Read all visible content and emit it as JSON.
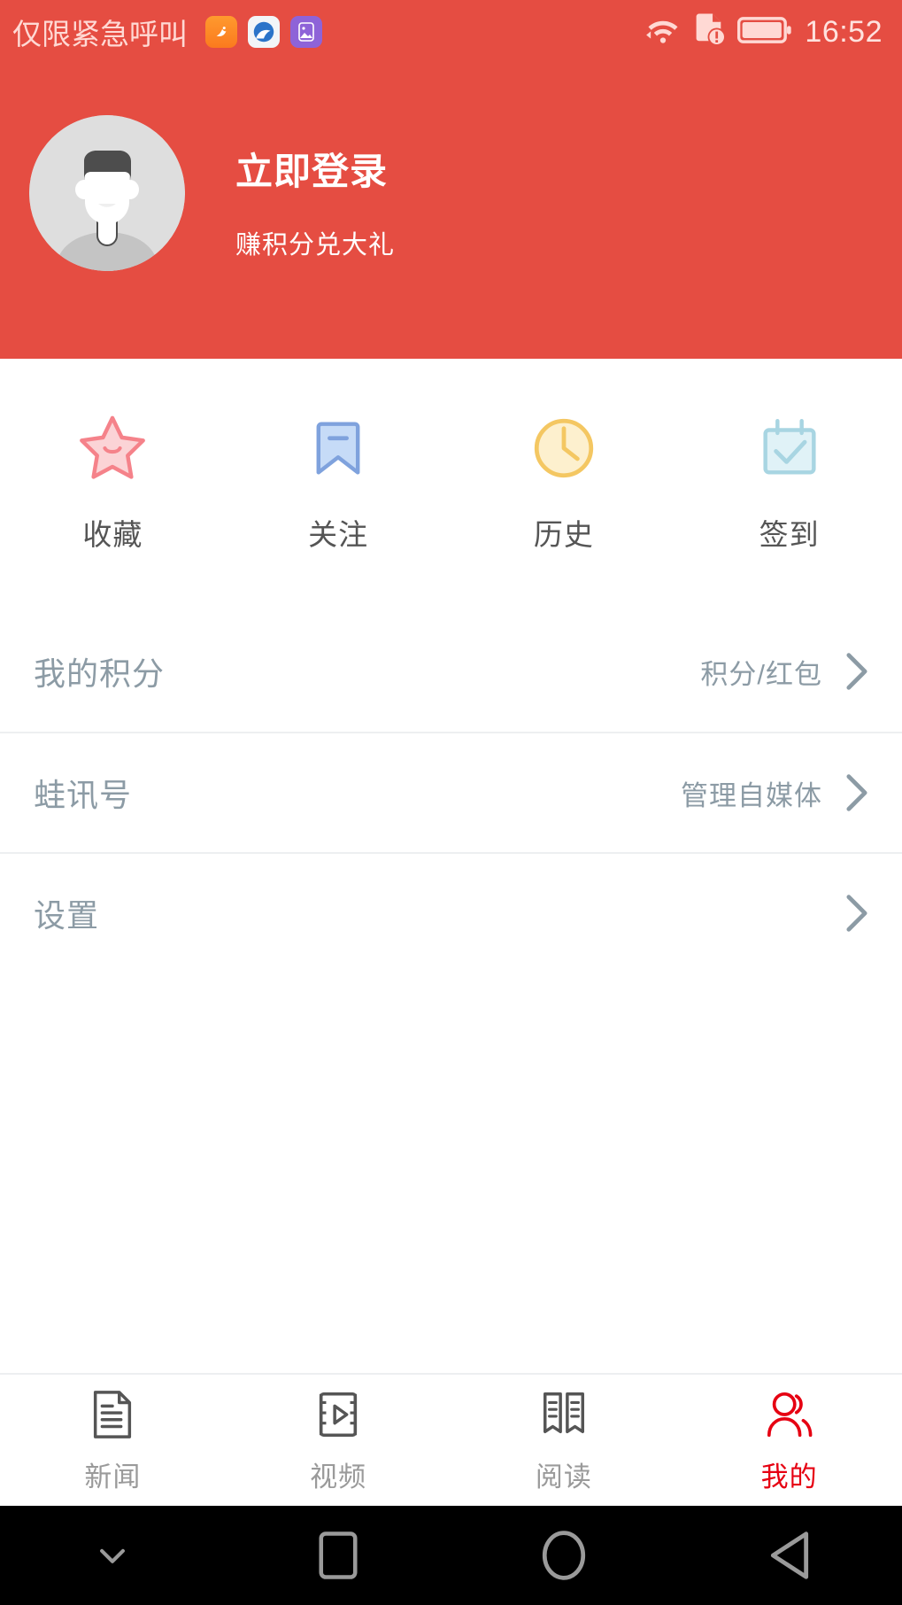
{
  "status_bar": {
    "carrier_text": "仅限紧急呼叫",
    "notification_icons": [
      "uc-browser-icon",
      "cloud-app-icon",
      "purple-app-icon"
    ],
    "system_icons": [
      "wifi-icon",
      "sim-alert-icon",
      "battery-icon"
    ],
    "time": "16:52"
  },
  "header": {
    "avatar": "default-user-avatar",
    "login_title": "立即登录",
    "login_subtitle": "赚积分兑大礼",
    "background_color": "#E54D42"
  },
  "quick_actions": [
    {
      "label": "收藏",
      "icon": "star-icon",
      "color": "#F5828A"
    },
    {
      "label": "关注",
      "icon": "bookmark-icon",
      "color": "#7FA2DD"
    },
    {
      "label": "历史",
      "icon": "clock-icon",
      "color": "#F4C762"
    },
    {
      "label": "签到",
      "icon": "calendar-check-icon",
      "color": "#A8D5E2"
    }
  ],
  "list_rows": [
    {
      "title": "我的积分",
      "value": "积分/红包",
      "chevron": "chevron-right-icon"
    },
    {
      "title": "蛙讯号",
      "value": "管理自媒体",
      "chevron": "chevron-right-icon"
    },
    {
      "title": "设置",
      "value": "",
      "chevron": "chevron-right-icon"
    }
  ],
  "tab_bar": {
    "active_color": "#E60012",
    "inactive_color": "#9A9A9A",
    "tabs": [
      {
        "label": "新闻",
        "icon": "document-icon",
        "active": false
      },
      {
        "label": "视频",
        "icon": "film-play-icon",
        "active": false
      },
      {
        "label": "阅读",
        "icon": "open-book-icon",
        "active": false
      },
      {
        "label": "我的",
        "icon": "people-icon",
        "active": true
      }
    ]
  },
  "android_nav": {
    "buttons": [
      "hide-nav-chevron-icon",
      "recents-square-icon",
      "home-circle-icon",
      "back-triangle-icon"
    ]
  }
}
